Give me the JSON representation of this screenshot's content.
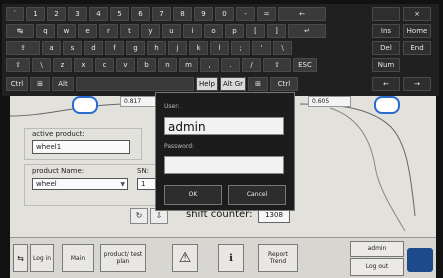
{
  "keyboard": {
    "row1": [
      "`",
      "1",
      "2",
      "3",
      "4",
      "5",
      "6",
      "7",
      "8",
      "9",
      "0",
      "-",
      "=",
      "←"
    ],
    "row1_extra": [
      "",
      "×"
    ],
    "row2": [
      "↹",
      "q",
      "w",
      "e",
      "r",
      "t",
      "y",
      "u",
      "i",
      "o",
      "p",
      "[",
      "]",
      "↵"
    ],
    "row2_extra": [
      "Ins",
      "Home"
    ],
    "row3": [
      "⇪",
      "a",
      "s",
      "d",
      "f",
      "g",
      "h",
      "j",
      "k",
      "l",
      ";",
      "'",
      "\\"
    ],
    "row3_extra": [
      "Del",
      "End"
    ],
    "row4": [
      "⇧",
      "\\",
      "z",
      "x",
      "c",
      "v",
      "b",
      "n",
      "m",
      ",",
      ".",
      "/",
      "⇧",
      "ESC"
    ],
    "row4_extra": [
      "Num"
    ],
    "row5": [
      "Ctrl",
      "⊞",
      "Alt",
      "",
      "Help",
      "Alt Gr",
      "⊞",
      "Ctrl"
    ],
    "row5_extra": [
      "←",
      "→"
    ]
  },
  "app": {
    "readout_left": "0.817",
    "readout_right": "0.605",
    "active_product_label": "active product:",
    "active_product_value": "wheel1",
    "product_name_label": "product Name:",
    "product_name_value": "wheel",
    "sn_label": "SN:",
    "sn_value": "1",
    "refresh_icon": "↻",
    "save_icon": "⇩",
    "shift_counter_label": "shift counter:",
    "shift_counter_value": "1308"
  },
  "dialog": {
    "user_label": "User:",
    "user_value": "admin",
    "password_label": "Password:",
    "password_value": "",
    "ok_label": "OK",
    "cancel_label": "Cancel"
  },
  "toolbar": {
    "login_label": "Log in",
    "main_label": "Main",
    "product_label": "product/ test plan",
    "report_label": "Report Trend",
    "user_badge": "admin",
    "logout_label": "Log out"
  }
}
